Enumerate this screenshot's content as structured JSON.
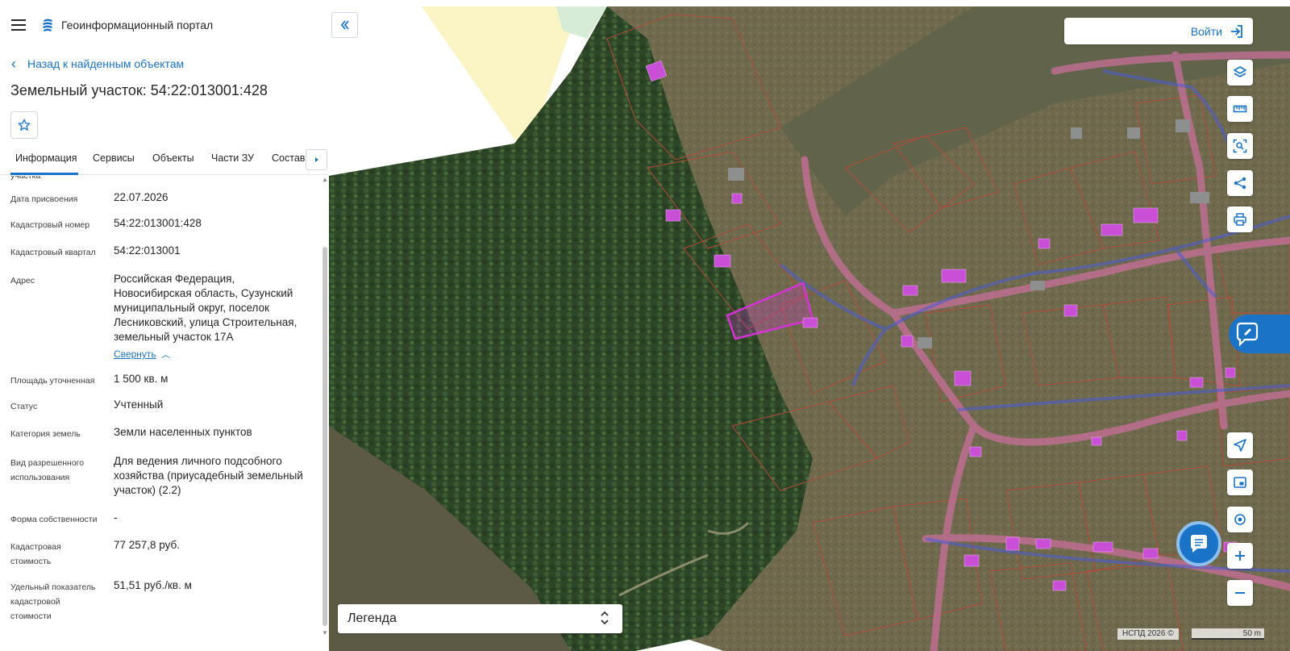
{
  "app": {
    "title": "Геоинформационный портал",
    "back_label": "Назад к найденным объектам",
    "object_title": "Земельный участок: 54:22:013001:428"
  },
  "tabs": [
    {
      "label": "Информация",
      "active": true
    },
    {
      "label": "Сервисы"
    },
    {
      "label": "Объекты"
    },
    {
      "label": "Части ЗУ"
    },
    {
      "label": "Состав"
    }
  ],
  "info": {
    "cut_label": "участка",
    "rows": [
      {
        "label": "Дата присвоения",
        "value": "22.07.2026"
      },
      {
        "label": "Кадастровый номер",
        "value": "54:22:013001:428"
      },
      {
        "label": "Кадастровый квартал",
        "value": "54:22:013001"
      },
      {
        "label": "Адрес",
        "value_lines": [
          "Российская Федерация,",
          "Новосибирская область, Сузунский",
          "муниципальный округ, поселок",
          "Лесниковский, улица Строительная,",
          "земельный участок 17А"
        ],
        "action": "Свернуть"
      },
      {
        "label": "Площадь уточненная",
        "value": "1 500 кв. м"
      },
      {
        "label": "Статус",
        "value": "Учтенный"
      },
      {
        "label": "Категория земель",
        "value": "Земли населенных пунктов"
      },
      {
        "label_lines": [
          "Вид разрешенного",
          "использования"
        ],
        "value_lines": [
          "Для ведения личного подсобного",
          "хозяйства (приусадебный земельный",
          "участок) (2.2)"
        ]
      },
      {
        "label": "Форма собственности",
        "value": "-"
      },
      {
        "label_lines": [
          "Кадастровая",
          "стоимость"
        ],
        "value": "77 257,8 руб."
      },
      {
        "label_lines": [
          "Удельный показатель",
          "кадастровой",
          "стоимости"
        ],
        "value": "51,51 руб./кв. м"
      }
    ]
  },
  "map": {
    "login_label": "Войти",
    "legend_label": "Легенда",
    "attribution": "НСПД 2026 ©",
    "scale_label": "50 m"
  },
  "colors": {
    "accent": "#1a73c7",
    "parcel_outline": "#c0392b",
    "selected_parcel": "#d633d6",
    "building": "#c94fd6",
    "road_network": "#4a5bd6",
    "forest": "#2f4a2a",
    "zone_yellow": "#fbf4c4"
  },
  "icons": {
    "menu": "hamburger-icon",
    "back": "chevron-left-icon",
    "favorite": "star-icon",
    "tabs_next": "chevron-right-icon",
    "collapse_panel": "double-chevron-left-icon",
    "login": "login-icon",
    "tools": [
      "layers-icon",
      "ruler-icon",
      "area-select-icon",
      "share-icon",
      "print-icon",
      "navigate-icon",
      "minimap-icon",
      "location-icon",
      "zoom-in-icon",
      "zoom-out-icon"
    ],
    "chat": "chat-icon",
    "legend_toggle": "chevron-updown-icon"
  }
}
